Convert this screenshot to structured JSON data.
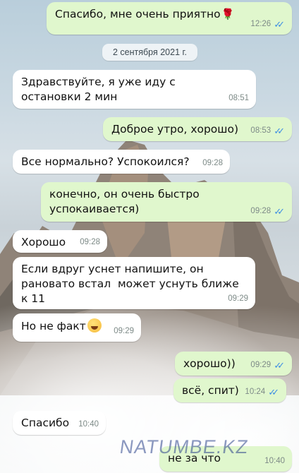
{
  "messages": [
    {
      "text": "Спасибо, мне очень приятно",
      "time": "12:26",
      "dir": "out"
    },
    {
      "text": "Здравствуйте, я уже иду с остановки 2 мин",
      "time": "08:51",
      "dir": "in"
    },
    {
      "text": "Доброе утро, хорошо)",
      "time": "08:53",
      "dir": "out"
    },
    {
      "text": "Все нормально? Успокоился?",
      "time": "09:28",
      "dir": "in"
    },
    {
      "text": "конечно, он очень быстро успокаивается)",
      "time": "09:28",
      "dir": "out"
    },
    {
      "text": "Хорошо",
      "time": "09:28",
      "dir": "in"
    },
    {
      "text": "Если вдруг уснет напишите, он рановато встал  может уснуть ближе к 11",
      "time": "09:29",
      "dir": "in"
    },
    {
      "text": "Но не факт",
      "time": "09:29",
      "dir": "in"
    },
    {
      "text": "хорошо))",
      "time": "09:29",
      "dir": "out"
    },
    {
      "text": "всё, спит)",
      "time": "10:24",
      "dir": "out"
    },
    {
      "text": "Спасибо",
      "time": "10:40",
      "dir": "in"
    },
    {
      "text": "не за что",
      "time": "10:40",
      "dir": "out"
    }
  ],
  "date_divider": "2 сентября 2021 г.",
  "read_ticks": "✓✓",
  "icons": {
    "rose": "rose-emoji-icon",
    "sweat_smile": "sweat-smile-emoji-icon",
    "read": "double-check-icon"
  },
  "colors": {
    "outgoing": "#e0f7cd",
    "incoming": "#ffffff",
    "ticks": "#3f8fe3"
  },
  "watermark": "NATUMBE.KZ"
}
